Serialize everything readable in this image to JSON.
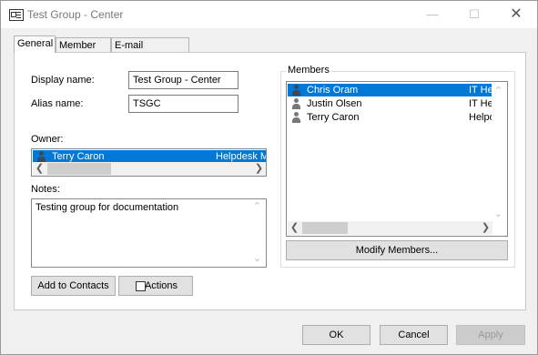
{
  "window": {
    "title": "Test Group - Center"
  },
  "tabs": [
    {
      "label": "General"
    },
    {
      "label": "Member Of"
    },
    {
      "label": "E-mail Addresses"
    }
  ],
  "general": {
    "display_name_label": "Display name:",
    "display_name_value": "Test Group - Center",
    "alias_name_label": "Alias name:",
    "alias_name_value": "TSGC",
    "owner_label": "Owner:",
    "owner": {
      "name": "Terry Caron",
      "role": "Helpdesk M"
    },
    "notes_label": "Notes:",
    "notes_value": "Testing group for documentation",
    "add_to_contacts_label": "Add to Contacts",
    "actions_label": "Actions"
  },
  "members": {
    "label": "Members",
    "items": [
      {
        "name": "Chris Oram",
        "role": "IT He",
        "selected": true
      },
      {
        "name": "Justin Olsen",
        "role": "IT He",
        "selected": false
      },
      {
        "name": "Terry Caron",
        "role": "Helpd",
        "selected": false
      }
    ],
    "modify_label": "Modify Members..."
  },
  "footer": {
    "ok_label": "OK",
    "cancel_label": "Cancel",
    "apply_label": "Apply"
  }
}
